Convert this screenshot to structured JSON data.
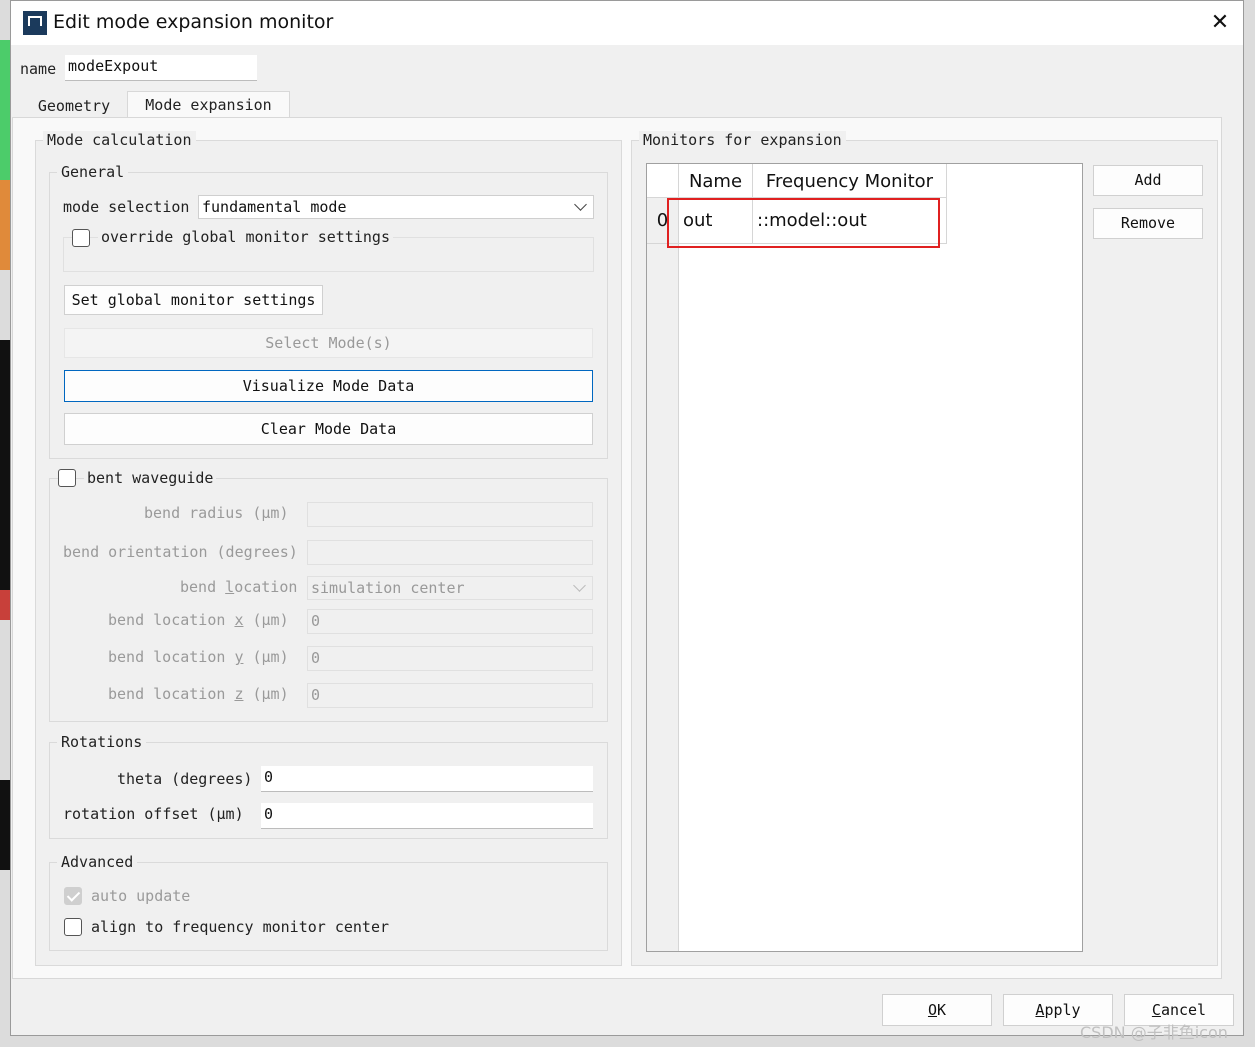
{
  "window": {
    "title": "Edit mode expansion monitor",
    "close_label": "✕"
  },
  "name_field": {
    "label": "name",
    "value": "modeExpout"
  },
  "tabs": [
    {
      "label": "Geometry"
    },
    {
      "label": "Mode expansion"
    }
  ],
  "mode_calc": {
    "title": "Mode calculation",
    "general": {
      "title": "General",
      "mode_selection_label": "mode selection",
      "mode_selection_value": "fundamental mode",
      "override_label": "override global monitor settings",
      "set_global_button": "Set global monitor settings",
      "select_modes_button": "Select Mode(s)",
      "visualize_button": "Visualize Mode Data",
      "clear_button": "Clear Mode Data"
    },
    "bent": {
      "label": "bent waveguide",
      "bend_radius_label": "bend radius (μm)",
      "bend_orientation_label": "bend orientation (degrees)",
      "bend_location_label_pre": "bend ",
      "bend_location_label_u": "l",
      "bend_location_label_post": "ocation",
      "bend_location_value": "simulation center",
      "bend_x_pre": "bend location ",
      "bend_x_u": "x",
      "bend_x_post": " (μm)",
      "bend_x_value": "0",
      "bend_y_pre": "bend location ",
      "bend_y_u": "y",
      "bend_y_post": " (μm)",
      "bend_y_value": "0",
      "bend_z_pre": "bend location ",
      "bend_z_u": "z",
      "bend_z_post": " (μm)",
      "bend_z_value": "0"
    },
    "rotations": {
      "title": "Rotations",
      "theta_label": "theta (degrees)",
      "theta_value": "0",
      "offset_label": "rotation offset (μm)",
      "offset_value": "0"
    },
    "advanced": {
      "title": "Advanced",
      "auto_update_label": "auto update",
      "align_label": "align to frequency monitor center"
    }
  },
  "monitors": {
    "title": "Monitors for expansion",
    "columns": [
      "Name",
      "Frequency Monitor"
    ],
    "rows": [
      {
        "index": "0",
        "name": "out",
        "monitor": "::model::out"
      }
    ],
    "add_button": "Add",
    "remove_button": "Remove"
  },
  "footer": {
    "ok_button": "OK",
    "apply_pre": "",
    "apply_u": "A",
    "apply_post": "pply",
    "cancel_pre": "",
    "cancel_u": "C",
    "cancel_post": "ancel",
    "ok_u": "O",
    "ok_post": "K"
  },
  "watermark": "CSDN @子非鱼icon",
  "colors": {
    "highlight": "#e02020",
    "focus": "#0067c0"
  }
}
